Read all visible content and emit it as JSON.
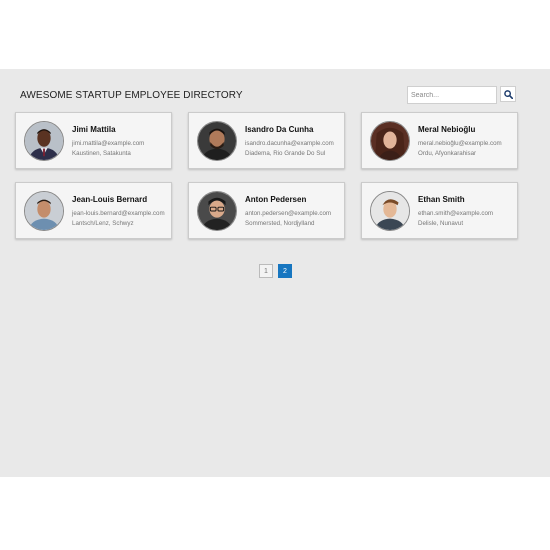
{
  "header": {
    "title": "AWESOME STARTUP EMPLOYEE DIRECTORY",
    "search_placeholder": "Search...",
    "search_icon": "magnifier-icon"
  },
  "employees": [
    {
      "name": "Jimi Mattila",
      "email": "jimi.mattila@example.com",
      "location": "Kaustinen, Satakunta"
    },
    {
      "name": "Isandro Da Cunha",
      "email": "isandro.dacunha@example.com",
      "location": "Diadema, Rio Grande Do Sul"
    },
    {
      "name": "Meral Nebioğlu",
      "email": "meral.nebioğlu@example.com",
      "location": "Ordu, Afyonkarahisar"
    },
    {
      "name": "Jean-Louis Bernard",
      "email": "jean-louis.bernard@example.com",
      "location": "Lantsch/Lenz, Schwyz"
    },
    {
      "name": "Anton Pedersen",
      "email": "anton.pedersen@example.com",
      "location": "Sommersted, Nordjylland"
    },
    {
      "name": "Ethan Smith",
      "email": "ethan.smith@example.com",
      "location": "Delisle, Nunavut"
    }
  ],
  "pagination": {
    "pages": [
      "1",
      "2"
    ],
    "current": "2"
  },
  "colors": {
    "accent": "#1776c0",
    "background": "#e9e9e9",
    "card": "#f5f5f5"
  }
}
